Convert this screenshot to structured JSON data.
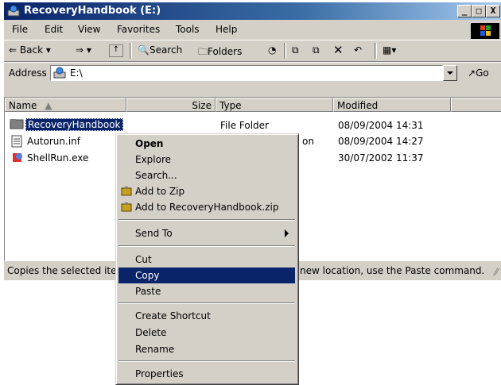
{
  "window": {
    "title": "RecoveryHandbook (E:)",
    "min_label": "_",
    "max_label": "□",
    "close_label": "X"
  },
  "menubar": [
    "File",
    "Edit",
    "View",
    "Favorites",
    "Tools",
    "Help"
  ],
  "toolbar": {
    "back_label": "Back",
    "search_label": "Search",
    "folders_label": "Folders"
  },
  "address": {
    "label": "Address",
    "value": "E:\\",
    "go_label": "Go"
  },
  "columns": [
    "Name",
    "Size",
    "Type",
    "Modified"
  ],
  "files": [
    {
      "name": "RecoveryHandbook",
      "size": "",
      "type": "File Folder",
      "modified": "08/09/2004 14:31"
    },
    {
      "name": "Autorun.inf",
      "size": "",
      "type": "on",
      "modified": "08/09/2004 14:27"
    },
    {
      "name": "ShellRun.exe",
      "size": "",
      "type": "",
      "modified": "30/07/2002 11:37"
    }
  ],
  "status": {
    "left": "Copies the selected ite",
    "right": "new location, use the Paste command."
  },
  "context_menu": {
    "open": "Open",
    "explore": "Explore",
    "search": "Search...",
    "add_zip": "Add to Zip",
    "add_named_zip": "Add to RecoveryHandbook.zip",
    "send_to": "Send To",
    "cut": "Cut",
    "copy": "Copy",
    "paste": "Paste",
    "create_shortcut": "Create Shortcut",
    "delete": "Delete",
    "rename": "Rename",
    "properties": "Properties"
  },
  "colors": {
    "selection": "#0a246a",
    "face": "#d4d0c8"
  }
}
